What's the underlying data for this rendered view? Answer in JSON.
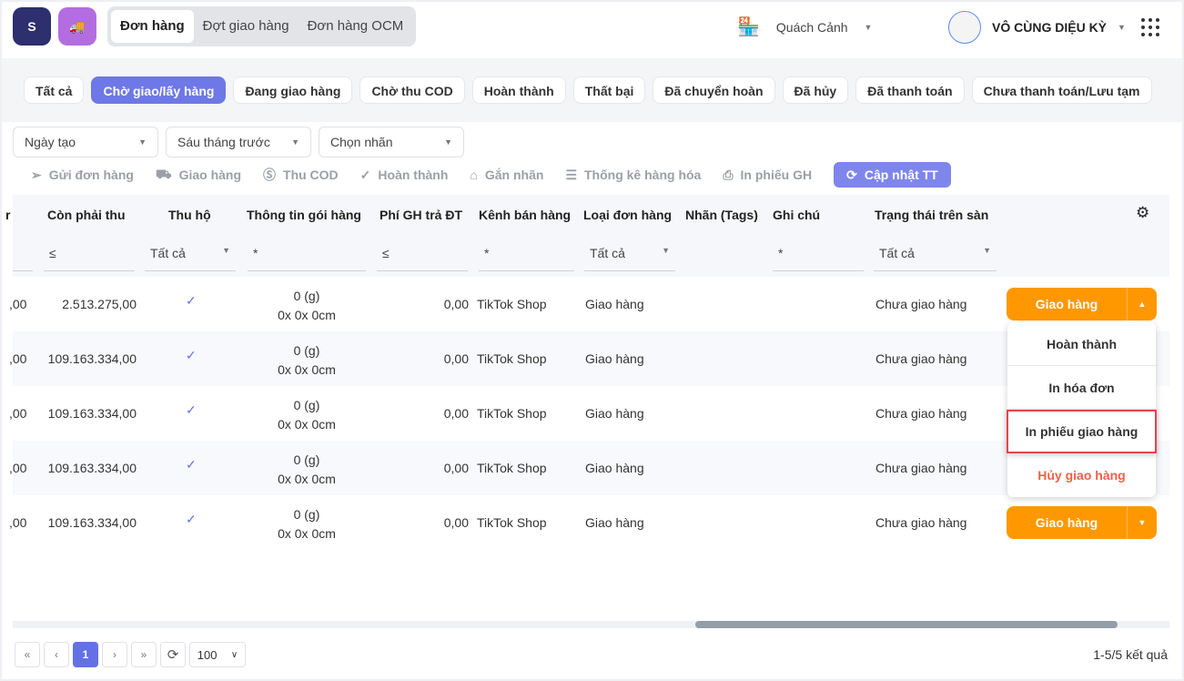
{
  "header": {
    "nav_tabs": [
      "Đơn hàng",
      "Đợt giao hàng",
      "Đơn hàng OCM"
    ],
    "active_tab": 0,
    "store": "Quách Cảnh",
    "user": "VÔ CÙNG DIỆU KỲ"
  },
  "status_chips": [
    "Tất cả",
    "Chờ giao/lấy hàng",
    "Đang giao hàng",
    "Chờ thu COD",
    "Hoàn thành",
    "Thất bại",
    "Đã chuyển hoàn",
    "Đã hủy",
    "Đã thanh toán",
    "Chưa thanh toán/Lưu tạm"
  ],
  "active_chip": 1,
  "filters": [
    "Ngày tạo",
    "Sáu tháng trước",
    "Chọn nhãn"
  ],
  "actions": [
    "Gửi đơn hàng",
    "Giao hàng",
    "Thu COD",
    "Hoàn thành",
    "Gắn nhãn",
    "Thống kê hàng hóa",
    "In phiếu GH"
  ],
  "update_button": "Cập nhật TT",
  "table": {
    "columns": [
      "r",
      "Còn phải thu",
      "Thu hộ",
      "Thông tin gói hàng",
      "Phí GH trả ĐT",
      "Kênh bán hàng",
      "Loại đơn hàng",
      "Nhãn (Tags)",
      "Ghi chú",
      "Trạng thái trên sàn"
    ],
    "filter_values": {
      "le": "≤",
      "star": "*",
      "all": "Tất cả"
    },
    "rows": [
      {
        "prev": ",00",
        "remaining": "2.513.275,00",
        "weight": "0 (g)",
        "dims": "0x 0x 0cm",
        "fee": "0,00",
        "channel": "TikTok Shop",
        "type": "Giao hàng",
        "status": "Chưa giao hàng"
      },
      {
        "prev": ",00",
        "remaining": "109.163.334,00",
        "weight": "0 (g)",
        "dims": "0x 0x 0cm",
        "fee": "0,00",
        "channel": "TikTok Shop",
        "type": "Giao hàng",
        "status": "Chưa giao hàng"
      },
      {
        "prev": ",00",
        "remaining": "109.163.334,00",
        "weight": "0 (g)",
        "dims": "0x 0x 0cm",
        "fee": "0,00",
        "channel": "TikTok Shop",
        "type": "Giao hàng",
        "status": "Chưa giao hàng"
      },
      {
        "prev": ",00",
        "remaining": "109.163.334,00",
        "weight": "0 (g)",
        "dims": "0x 0x 0cm",
        "fee": "0,00",
        "channel": "TikTok Shop",
        "type": "Giao hàng",
        "status": "Chưa giao hàng"
      },
      {
        "prev": ",00",
        "remaining": "109.163.334,00",
        "weight": "0 (g)",
        "dims": "0x 0x 0cm",
        "fee": "0,00",
        "channel": "TikTok Shop",
        "type": "Giao hàng",
        "status": "Chưa giao hàng"
      }
    ],
    "row_action": "Giao hàng"
  },
  "dropdown_menu": [
    "Hoàn thành",
    "In hóa đơn",
    "In phiếu giao hàng",
    "Hủy giao hàng"
  ],
  "pagination": {
    "first": "«",
    "prev": "‹",
    "page": "1",
    "next": "›",
    "last": "»",
    "page_size": "100",
    "result": "1-5/5 kết quả"
  },
  "colors": {
    "accent": "#6e78e6",
    "orange": "#ff9800",
    "danger": "#f0604a"
  }
}
